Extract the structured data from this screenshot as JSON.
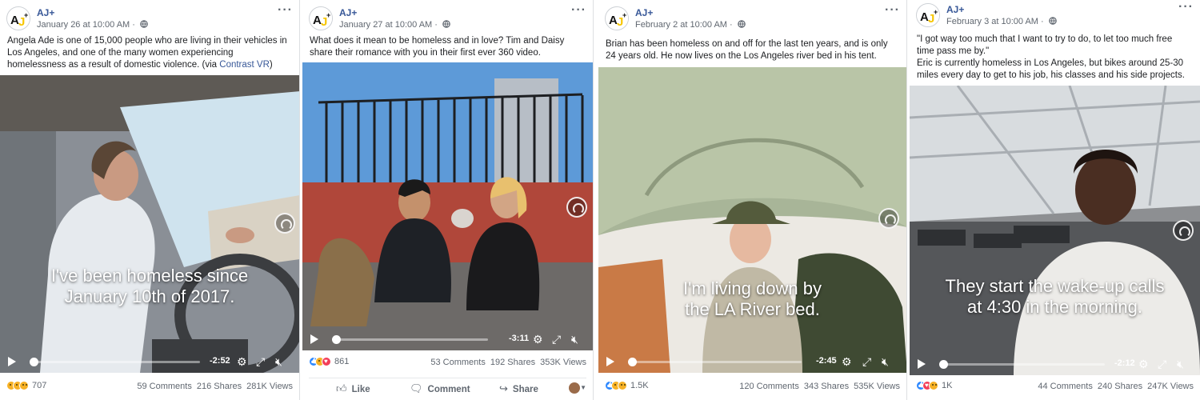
{
  "posts": [
    {
      "page_name": "AJ+",
      "date": "January 26 at 10:00 AM · ",
      "caption": "Angela Ade is one of 15,000 people who are living in their vehicles in Los Angeles, and one of the many women experiencing homelessness as a result of domestic violence. (via ",
      "caption_link": "Contrast VR",
      "caption_end": ")",
      "subtitle_line1": "I've been homeless since",
      "subtitle_line2": "January 10th of 2017.",
      "time_remaining": "-2:52",
      "reaction_count": "707",
      "comments": "59 Comments",
      "shares": "216 Shares",
      "views": "281K Views"
    },
    {
      "page_name": "AJ+",
      "date": "January 27 at 10:00 AM · ",
      "caption": "What does it mean to be homeless and in love? Tim and Daisy share their romance with you in their first ever 360 video.",
      "time_remaining": "-3:11",
      "reaction_count": "861",
      "comments": "53 Comments",
      "shares": "192 Shares",
      "views": "353K Views",
      "actions": {
        "like": "Like",
        "comment": "Comment",
        "share": "Share"
      }
    },
    {
      "page_name": "AJ+",
      "date": "February 2 at 10:00 AM · ",
      "caption": "Brian has been homeless on and off for the last ten years, and is only 24 years old. He now lives on the Los Angeles river bed in his tent.",
      "subtitle_line1": "I'm living down by",
      "subtitle_line2": "the LA River bed.",
      "time_remaining": "-2:45",
      "reaction_count": "1.5K",
      "comments": "120 Comments",
      "shares": "343 Shares",
      "views": "535K Views"
    },
    {
      "page_name": "AJ+",
      "date": "February 3 at 10:00 AM · ",
      "caption": "\"I got way too much that I want to try to do, to let too much free time pass me by.\"",
      "caption2": "Eric is currently homeless in Los Angeles, but bikes around 25-30 miles every day to get to his job, his classes and his side projects.",
      "subtitle_line1": "They start the wake-up calls",
      "subtitle_line2": "at 4:30 in the morning.",
      "time_remaining": "-2:12",
      "reaction_count": "1K",
      "comments": "44 Comments",
      "shares": "240 Shares",
      "views": "247K Views"
    }
  ],
  "colors": {
    "link": "#385898",
    "like_reaction": "#2d88ff",
    "love_reaction": "#f33e58",
    "haha_reaction": "#f7b125",
    "logo_yellow": "#f7c600"
  }
}
